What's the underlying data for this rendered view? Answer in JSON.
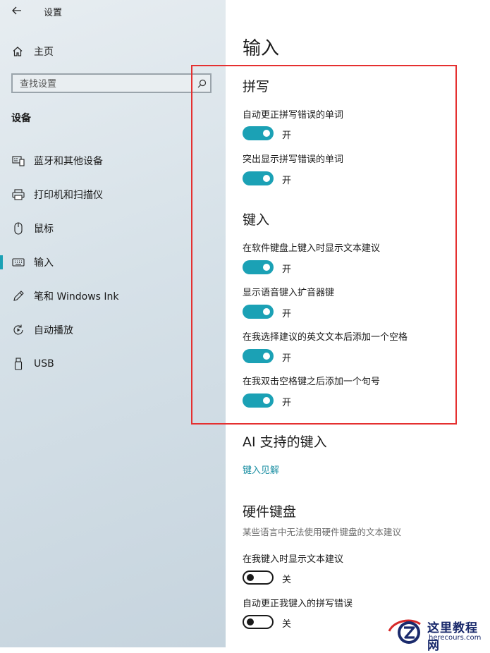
{
  "window": {
    "title": "设置"
  },
  "sidebar": {
    "home_label": "主页",
    "search_placeholder": "查找设置",
    "section_title": "设备",
    "items": [
      {
        "label": "蓝牙和其他设备",
        "icon": "bluetooth-devices-icon",
        "selected": false
      },
      {
        "label": "打印机和扫描仪",
        "icon": "printer-icon",
        "selected": false
      },
      {
        "label": "鼠标",
        "icon": "mouse-icon",
        "selected": false
      },
      {
        "label": "输入",
        "icon": "keyboard-icon",
        "selected": true
      },
      {
        "label": "笔和 Windows Ink",
        "icon": "pen-icon",
        "selected": false
      },
      {
        "label": "自动播放",
        "icon": "autoplay-icon",
        "selected": false
      },
      {
        "label": "USB",
        "icon": "usb-icon",
        "selected": false
      }
    ]
  },
  "main": {
    "title": "输入",
    "spelling": {
      "title": "拼写",
      "settings": [
        {
          "label": "自动更正拼写错误的单词",
          "state": "开",
          "on": true
        },
        {
          "label": "突出显示拼写错误的单词",
          "state": "开",
          "on": true
        }
      ]
    },
    "typing": {
      "title": "键入",
      "settings": [
        {
          "label": "在软件键盘上键入时显示文本建议",
          "state": "开",
          "on": true
        },
        {
          "label": "显示语音键入扩音器键",
          "state": "开",
          "on": true
        },
        {
          "label": "在我选择建议的英文文本后添加一个空格",
          "state": "开",
          "on": true
        },
        {
          "label": "在我双击空格键之后添加一个句号",
          "state": "开",
          "on": true
        }
      ]
    },
    "ai": {
      "title": "AI 支持的键入",
      "link": "键入见解"
    },
    "hardware": {
      "title": "硬件键盘",
      "description": "某些语言中无法使用硬件键盘的文本建议",
      "settings": [
        {
          "label": "在我键入时显示文本建议",
          "state": "关",
          "on": false
        },
        {
          "label": "自动更正我键入的拼写错误",
          "state": "关",
          "on": false
        }
      ]
    }
  },
  "colors": {
    "accent": "#1ba1b5",
    "highlight": "#e53030"
  },
  "watermark": {
    "line1": "这里教程网",
    "line2": "herecours.com"
  }
}
